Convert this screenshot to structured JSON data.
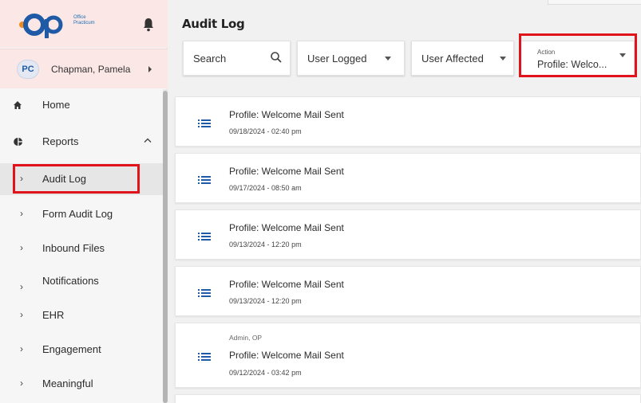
{
  "sidebar": {
    "brand_text": "Office Practicum",
    "user": {
      "initials": "PC",
      "name": "Chapman, Pamela"
    },
    "items": [
      {
        "label": "Home",
        "icon": "home-icon"
      },
      {
        "label": "Reports",
        "icon": "pie-chart-icon",
        "expanded": true
      },
      {
        "label": "Audit Log",
        "selected": true
      },
      {
        "label": "Form Audit Log"
      },
      {
        "label": "Inbound Files"
      },
      {
        "label": "Notifications"
      },
      {
        "label": "EHR"
      },
      {
        "label": "Engagement"
      },
      {
        "label": "Meaningful"
      }
    ]
  },
  "main": {
    "title": "Audit Log",
    "filters": {
      "search_label": "Search",
      "user_logged_label": "User Logged",
      "user_affected_label": "User Affected",
      "action_label": "Action",
      "action_value": "Profile: Welco..."
    },
    "entries": [
      {
        "user": "",
        "title": "Profile: Welcome Mail Sent",
        "date": "09/18/2024 - 02:40 pm"
      },
      {
        "user": "",
        "title": "Profile: Welcome Mail Sent",
        "date": "09/17/2024 - 08:50 am"
      },
      {
        "user": "",
        "title": "Profile: Welcome Mail Sent",
        "date": "09/13/2024 - 12:20 pm"
      },
      {
        "user": "",
        "title": "Profile: Welcome Mail Sent",
        "date": "09/13/2024 - 12:20 pm"
      },
      {
        "user": "Admin, OP",
        "title": "Profile: Welcome Mail Sent",
        "date": "09/12/2024 - 03:42 pm"
      }
    ]
  },
  "colors": {
    "highlight": "#e0131b",
    "brand_blue": "#1f5aa6",
    "brand_orange": "#f08a1e",
    "header_bg": "#fbe8e6"
  }
}
